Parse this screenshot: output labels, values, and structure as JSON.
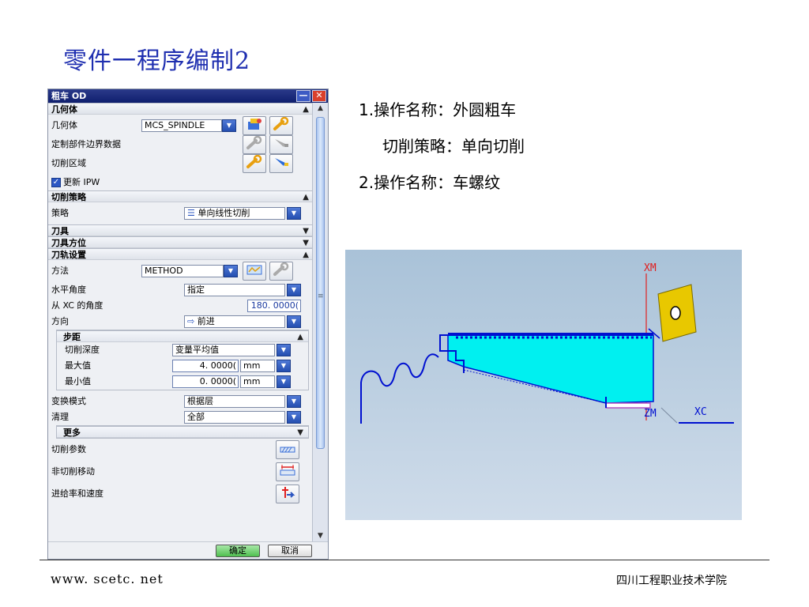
{
  "slide": {
    "title": "零件一程序编制2",
    "footer_left": "www. scetc. net",
    "footer_right": "四川工程职业技术学院"
  },
  "dialog": {
    "title": "粗车 OD",
    "min_label": "—",
    "close_label": "✕",
    "geometry": {
      "header": "几何体",
      "geom_label": "几何体",
      "geom_value": "MCS_SPINDLE",
      "custom_boundary_label": "定制部件边界数据",
      "cut_region_label": "切削区域",
      "update_ipw_label": "更新 IPW"
    },
    "cut_strategy": {
      "header": "切削策略",
      "strategy_label": "策略",
      "strategy_value": "单向线性切削"
    },
    "tool": {
      "header": "刀具"
    },
    "tool_orientation": {
      "header": "刀具方位"
    },
    "toolpath": {
      "header": "刀轨设置",
      "method_label": "方法",
      "method_value": "METHOD",
      "horizontal_angle_label": "水平角度",
      "horizontal_angle_value": "指定",
      "xc_angle_label": "从 XC 的角度",
      "xc_angle_value": "180. 0000(",
      "direction_label": "方向",
      "direction_value": "前进",
      "step": {
        "header": "步距",
        "depth_label": "切削深度",
        "depth_value": "变量平均值",
        "max_label": "最大值",
        "max_value": "4. 0000(",
        "min_label": "最小值",
        "min_value": "0. 0000(",
        "unit": "mm"
      },
      "transform_label": "变换模式",
      "transform_value": "根据层",
      "cleanup_label": "清理",
      "cleanup_value": "全部",
      "more_header": "更多",
      "cut_params_label": "切削参数",
      "non_cut_label": "非切削移动",
      "feeds_label": "进给率和速度"
    },
    "ok_label": "确定",
    "cancel_label": "取消"
  },
  "notes": {
    "line1": "1.操作名称：外圆粗车",
    "line2": "切削策略：单向切削",
    "line3": "2.操作名称：车螺纹"
  },
  "graphic": {
    "axis_xm": "XM",
    "axis_zm": "ZM",
    "axis_xc": "XC",
    "colors": {
      "part": "#00f0f0",
      "outline": "#0010d0",
      "insert": "#e8c800",
      "axis_red": "#e02020"
    }
  }
}
